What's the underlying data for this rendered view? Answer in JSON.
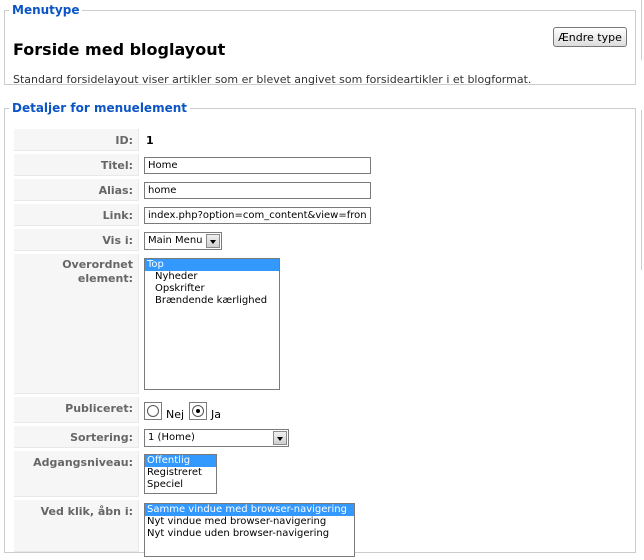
{
  "menutype": {
    "legend": "Menutype",
    "title": "Forside med bloglayout",
    "description": "Standard forsidelayout viser artikler som er blevet angivet som forsideartikler i et blogformat.",
    "change_button": "Ændre type"
  },
  "details": {
    "legend": "Detaljer for menuelement",
    "id": {
      "label": "ID:",
      "value": "1"
    },
    "title": {
      "label": "Titel:",
      "value": "Home"
    },
    "alias": {
      "label": "Alias:",
      "value": "home"
    },
    "link": {
      "label": "Link:",
      "value": "index.php?option=com_content&view=frontpage"
    },
    "show_in": {
      "label": "Vis i:",
      "value": "Main Menu"
    },
    "parent": {
      "label": "Overordnet element:",
      "options": [
        "Top",
        "Nyheder",
        "Opskrifter",
        "Brændende kærlighed"
      ],
      "selected": "Top"
    },
    "published": {
      "label": "Publiceret:",
      "options": [
        "Nej",
        "Ja"
      ],
      "selected": "Ja"
    },
    "ordering": {
      "label": "Sortering:",
      "value": "1 (Home)"
    },
    "access": {
      "label": "Adgangsniveau:",
      "options": [
        "Offentlig",
        "Registreret",
        "Speciel"
      ],
      "selected": "Offentlig"
    },
    "on_click": {
      "label": "Ved klik, åbn i:",
      "options": [
        "Samme vindue med browser-navigering",
        "Nyt vindue med browser-navigering",
        "Nyt vindue uden browser-navigering"
      ],
      "selected": "Samme vindue med browser-navigering"
    }
  }
}
